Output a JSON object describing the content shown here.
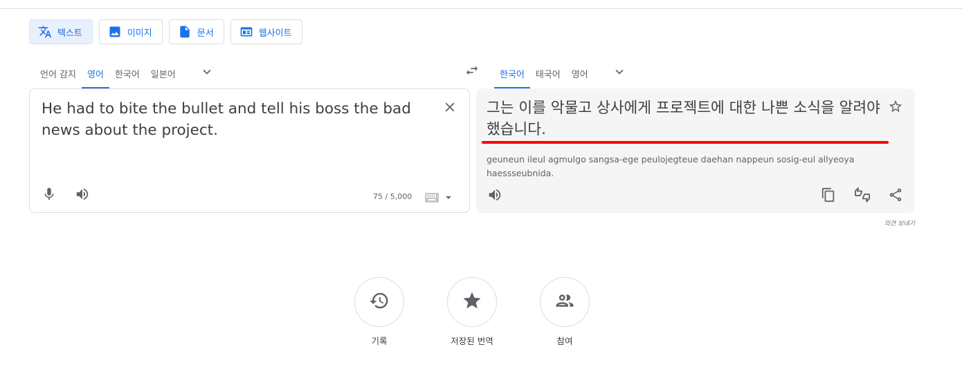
{
  "modes": [
    {
      "label": "텍스트",
      "icon": "translate-icon",
      "active": true
    },
    {
      "label": "이미지",
      "icon": "image-icon",
      "active": false
    },
    {
      "label": "문서",
      "icon": "document-icon",
      "active": false
    },
    {
      "label": "웹사이트",
      "icon": "website-icon",
      "active": false
    }
  ],
  "source_langs": [
    "언어 감지",
    "영어",
    "한국어",
    "일본어"
  ],
  "source_active": "영어",
  "target_langs": [
    "한국어",
    "태국어",
    "영어"
  ],
  "target_active": "한국어",
  "source": {
    "text": "He had to bite the bullet and tell his boss the bad news about the project.",
    "char_count": "75 / 5,000"
  },
  "target": {
    "text": "그는 이를 악물고 상사에게 프로젝트에 대한 나쁜 소식을 알려야 했습니다.",
    "transliteration": "geuneun ileul agmulgo sangsa-ege peulojegteue daehan nappeun sosig-eul allyeoya haessseubnida."
  },
  "feedback_label": "의견 보내기",
  "bottom": [
    {
      "label": "기록",
      "icon": "history-icon"
    },
    {
      "label": "저장된 번역",
      "icon": "star-icon"
    },
    {
      "label": "참여",
      "icon": "people-icon"
    }
  ],
  "colors": {
    "accent": "#1a73e8",
    "underline": "#ff0000",
    "panel_bg": "#f5f5f5"
  }
}
